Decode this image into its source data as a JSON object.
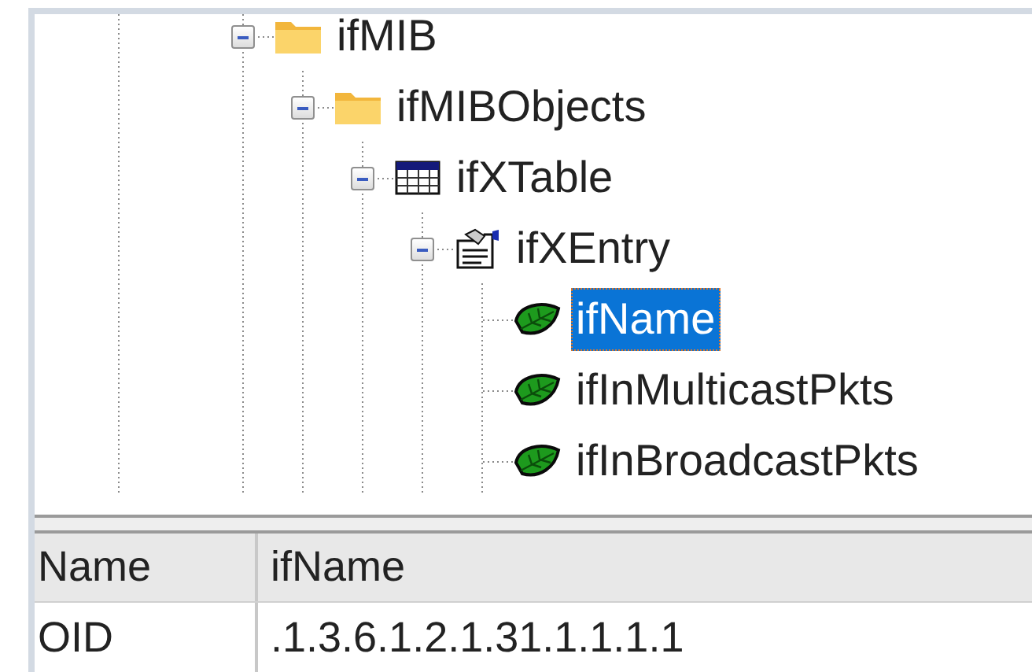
{
  "tree": [
    {
      "label": "ifMIB",
      "kind": "folder",
      "expanded": true,
      "selected": false,
      "children": [
        {
          "label": "ifMIBObjects",
          "kind": "folder",
          "expanded": true,
          "selected": false,
          "children": [
            {
              "label": "ifXTable",
              "kind": "table",
              "expanded": true,
              "selected": false,
              "children": [
                {
                  "label": "ifXEntry",
                  "kind": "entry",
                  "expanded": true,
                  "selected": false,
                  "children": [
                    {
                      "label": "ifName",
                      "kind": "leaf",
                      "selected": true
                    },
                    {
                      "label": "ifInMulticastPkts",
                      "kind": "leaf",
                      "selected": false
                    },
                    {
                      "label": "ifInBroadcastPkts",
                      "kind": "leaf",
                      "selected": false
                    }
                  ]
                }
              ]
            }
          ]
        }
      ]
    }
  ],
  "properties": [
    {
      "name": "Name",
      "value": "ifName"
    },
    {
      "name": "OID",
      "value": ".1.3.6.1.2.1.31.1.1.1.1"
    }
  ]
}
